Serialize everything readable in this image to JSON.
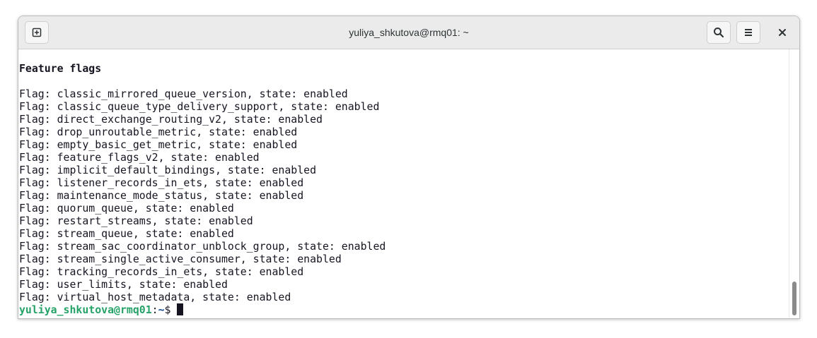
{
  "window": {
    "title": "yuliya_shkutova@rmq01: ~"
  },
  "icons": {
    "new_tab": "new-tab-icon",
    "search": "search-icon",
    "menu": "hamburger-menu-icon",
    "close": "close-icon"
  },
  "terminal": {
    "heading": "Feature flags",
    "flags": [
      "Flag: classic_mirrored_queue_version, state: enabled",
      "Flag: classic_queue_type_delivery_support, state: enabled",
      "Flag: direct_exchange_routing_v2, state: enabled",
      "Flag: drop_unroutable_metric, state: enabled",
      "Flag: empty_basic_get_metric, state: enabled",
      "Flag: feature_flags_v2, state: enabled",
      "Flag: implicit_default_bindings, state: enabled",
      "Flag: listener_records_in_ets, state: enabled",
      "Flag: maintenance_mode_status, state: enabled",
      "Flag: quorum_queue, state: enabled",
      "Flag: restart_streams, state: enabled",
      "Flag: stream_queue, state: enabled",
      "Flag: stream_sac_coordinator_unblock_group, state: enabled",
      "Flag: stream_single_active_consumer, state: enabled",
      "Flag: tracking_records_in_ets, state: enabled",
      "Flag: user_limits, state: enabled",
      "Flag: virtual_host_metadata, state: enabled"
    ],
    "prompt": {
      "user_host": "yuliya_shkutova@rmq01",
      "separator": ":",
      "path": "~",
      "symbol": "$ "
    }
  },
  "colors": {
    "prompt_user": "#26a269",
    "prompt_path": "#12488b",
    "text": "#171421",
    "titlebar": "#ebebeb"
  }
}
